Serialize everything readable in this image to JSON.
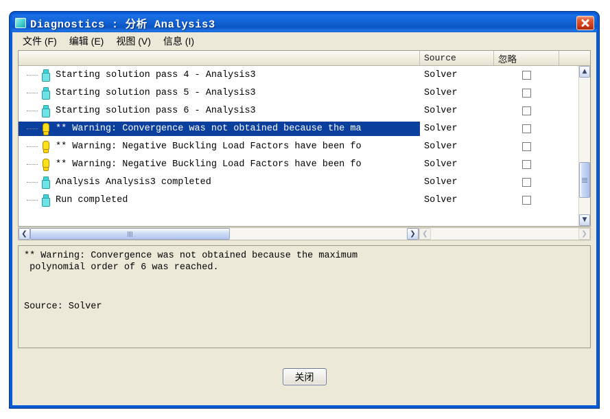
{
  "window": {
    "title": "Diagnostics : 分析 Analysis3",
    "icon": "app-window-icon",
    "close_glyph": "✕"
  },
  "menubar": {
    "items": [
      {
        "label": "文件 (F)"
      },
      {
        "label": "编辑 (E)"
      },
      {
        "label": "视图 (V)"
      },
      {
        "label": "信息 (I)"
      }
    ]
  },
  "listview": {
    "columns": [
      {
        "label": "",
        "key": "message"
      },
      {
        "label": "Source",
        "key": "source"
      },
      {
        "label": "忽略",
        "key": "ignore"
      }
    ],
    "rows": [
      {
        "icon": "info-icon",
        "message": "Starting solution pass 4 - Analysis3",
        "source": "Solver",
        "ignore": false,
        "selected": false
      },
      {
        "icon": "info-icon",
        "message": "Starting solution pass 5 - Analysis3",
        "source": "Solver",
        "ignore": false,
        "selected": false
      },
      {
        "icon": "info-icon",
        "message": "Starting solution pass 6 - Analysis3",
        "source": "Solver",
        "ignore": false,
        "selected": false
      },
      {
        "icon": "warning-icon",
        "message": "** Warning: Convergence was not obtained because the ma",
        "source": "Solver",
        "ignore": false,
        "selected": true
      },
      {
        "icon": "warning-icon",
        "message": "** Warning: Negative Buckling Load Factors have been fo",
        "source": "Solver",
        "ignore": false,
        "selected": false
      },
      {
        "icon": "warning-icon",
        "message": "** Warning: Negative Buckling Load Factors have been fo",
        "source": "Solver",
        "ignore": false,
        "selected": false
      },
      {
        "icon": "info-icon",
        "message": "Analysis Analysis3 completed",
        "source": "Solver",
        "ignore": false,
        "selected": false
      },
      {
        "icon": "info-icon",
        "message": "Run completed",
        "source": "Solver",
        "ignore": false,
        "selected": false
      }
    ],
    "scrollbar": {
      "up_glyph": "▲",
      "down_glyph": "▼",
      "left_glyph": "❮",
      "right_glyph": "❯"
    }
  },
  "detail": {
    "line1": "** Warning: Convergence was not obtained because the maximum",
    "line2": " polynomial order of 6 was reached.",
    "line3": "Source: Solver"
  },
  "footer": {
    "close_label": "关闭"
  },
  "colors": {
    "title_bar": "#0a5ad6",
    "selection": "#0b3f9e",
    "client_bg": "#ece9d8",
    "close_button": "#cf3916",
    "info_icon": "#6fe3e3",
    "warning_icon": "#ffe11a"
  }
}
